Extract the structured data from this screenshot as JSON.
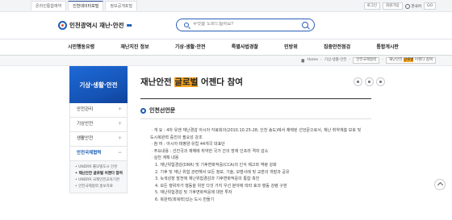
{
  "util": {
    "tabs": [
      "온라인통합예약",
      "인천데이터포털",
      "정보공개포털"
    ],
    "login": "로그인",
    "signup": "회원가입",
    "lang": "한국어",
    "go": "GO"
  },
  "header": {
    "logo_text": "인천광역시 재난·안전",
    "search_placeholder": "무엇을 도와드릴까요?"
  },
  "gnb": [
    "시민행동요령",
    "재난지진 정보",
    "기상·생활·안전",
    "특별사법경찰",
    "민방위",
    "집중안전점검",
    "통합게시판"
  ],
  "breadcrumb": {
    "home": "Home",
    "items": [
      "기상·생활·안전",
      "안전국제협력"
    ],
    "current_pre": "재난안전 ",
    "current_hl": "글로벌",
    "current_post": " 어젠다 참여"
  },
  "sidebar": {
    "title": "기상·생활·안전",
    "items": [
      "안전관리",
      "기상안전",
      "생활안전",
      "안전국제협력"
    ],
    "sub": [
      "UNDRR 롤모델도시 인천",
      "재난안전 글로벌 어젠다 참여",
      "UNDRR 국제안전교육기관",
      "안전국제협력 홍보자료"
    ]
  },
  "content": {
    "title_pre": "재난안전 ",
    "title_hl": "글로벌",
    "title_post": " 어젠다 참여",
    "section": "인천선언문",
    "lines": [
      "ㆍ개 요 : 4차 유엔 재난경감 아시아 각료회의(2010.10.25-28, 인천 송도)에서 채택된 선언문으로서, 재난 취약계층 보호 및",
      "   도시복원력 증진의 필요성 강조",
      "ㆍ참 여 : 아시아·태평양·유럽 44개국 대표단",
      "ㆍ주요내용 : 선진국과 재해에 취약한 국가 간의 방재 인프라 격차 감소",
      "ㆍ실천 계획 내용",
      "1. 재난위험경감(DRR) 및 기후변화적응(CCA)의 인식 제고와 역량 강화",
      "2. 기후 및 재난 위험 관련해서 모든 정보, 기술, 모범사례 및 교훈의 개발과 공유",
      "3. 녹색성장 발전에 재난위험경감과 기후변화적응의 통합 촉진",
      "4. 모든 행위자가 행동을 위한 다섯 가지 우선 분야에 따라 효과 행동 강령 구현",
      "5. 재난위험경감 및 기후변화적응에 대한 투자",
      "6. 복원력(회복력)있는 도시 만들기"
    ]
  }
}
